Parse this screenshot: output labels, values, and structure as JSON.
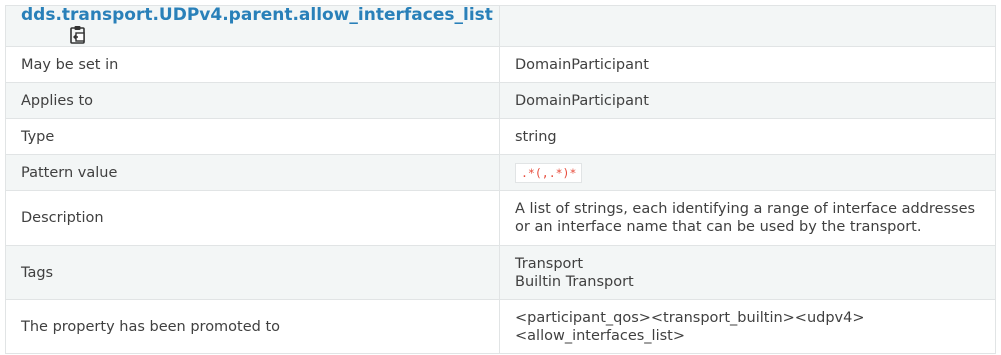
{
  "header": {
    "title": "dds.transport.UDPv4.parent.allow_interfaces_list",
    "copy_icon": "clipboard-copy-icon"
  },
  "rows": [
    {
      "label": "May be set in",
      "value": "DomainParticipant"
    },
    {
      "label": "Applies to",
      "value": "DomainParticipant"
    },
    {
      "label": "Type",
      "value": "string"
    },
    {
      "label": "Pattern value",
      "value": ".*(,.*)*"
    },
    {
      "label": "Description",
      "value": "A list of strings, each identifying a range of interface addresses or an interface name that can be used by the transport."
    },
    {
      "label": "Tags",
      "values": [
        "Transport",
        "Builtin Transport"
      ]
    },
    {
      "label": "The property has been promoted to",
      "values": [
        "<participant_qos><transport_builtin><udpv4>",
        "<allow_interfaces_list>"
      ]
    }
  ],
  "colors": {
    "title": "#2980b9",
    "code": "#e74c3c",
    "stripe": "#f3f6f6",
    "border": "#e1e4e5"
  }
}
